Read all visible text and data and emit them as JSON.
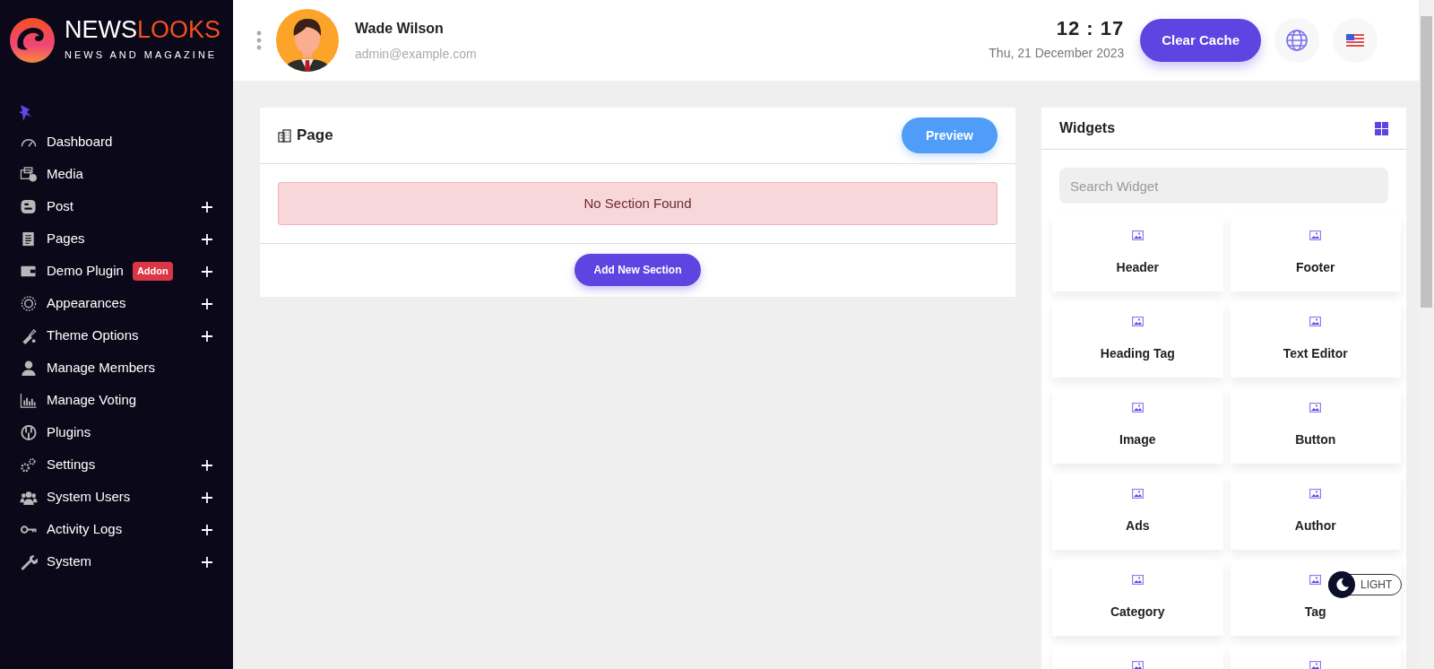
{
  "brand": {
    "name_part_1": "NEWS",
    "name_part_2": "LOOKS",
    "tagline": "NEWS AND MAGAZINE"
  },
  "sidebar": {
    "items": [
      {
        "label": "Dashboard",
        "expandable": false
      },
      {
        "label": "Media",
        "expandable": false
      },
      {
        "label": "Post",
        "expandable": true
      },
      {
        "label": "Pages",
        "expandable": true
      },
      {
        "label": "Demo Plugin",
        "badge": "Addon",
        "expandable": true
      },
      {
        "label": "Appearances",
        "expandable": true
      },
      {
        "label": "Theme Options",
        "expandable": true
      },
      {
        "label": "Manage Members",
        "expandable": false
      },
      {
        "label": "Manage Voting",
        "expandable": false
      },
      {
        "label": "Plugins",
        "expandable": false
      },
      {
        "label": "Settings",
        "expandable": true
      },
      {
        "label": "System Users",
        "expandable": true
      },
      {
        "label": "Activity Logs",
        "expandable": true
      },
      {
        "label": "System",
        "expandable": true
      }
    ]
  },
  "header": {
    "user_name": "Wade Wilson",
    "user_email": "admin@example.com",
    "time": "12 : 17",
    "date": "Thu, 21 December 2023",
    "clear_cache_button": "Clear Cache"
  },
  "page_panel": {
    "title": "Page",
    "preview_button": "Preview",
    "alert": "No Section Found",
    "add_button": "Add New Section"
  },
  "widgets_panel": {
    "title": "Widgets",
    "search": {
      "placeholder": "Search Widget"
    },
    "widgets": [
      {
        "kind": "labelled",
        "label": "Header"
      },
      {
        "kind": "labelled",
        "label": "Footer"
      },
      {
        "kind": "labelled",
        "label": "Heading Tag"
      },
      {
        "kind": "labelled",
        "label": "Text Editor"
      },
      {
        "kind": "labelled",
        "label": "Image"
      },
      {
        "kind": "labelled",
        "label": "Button"
      },
      {
        "kind": "labelled",
        "label": "Ads"
      },
      {
        "kind": "labelled",
        "label": "Author"
      },
      {
        "kind": "labelled",
        "label": "Category"
      },
      {
        "kind": "labelled",
        "label": "Tag"
      },
      {
        "kind": "icon-only"
      },
      {
        "kind": "icon-only"
      }
    ]
  },
  "theme_toggle": {
    "label": "LIGHT"
  }
}
